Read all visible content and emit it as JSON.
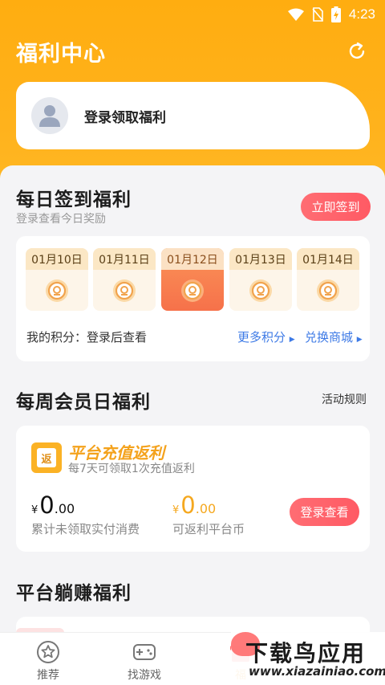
{
  "status_bar": {
    "time": "4:23"
  },
  "header": {
    "title": "福利中心"
  },
  "login_card": {
    "text": "登录领取福利"
  },
  "daily": {
    "title": "每日签到福利",
    "subtitle": "登录查看今日奖励",
    "button": "立即签到",
    "days": [
      "01月10日",
      "01月11日",
      "01月12日",
      "01月13日",
      "01月14日"
    ],
    "active_index": 2,
    "points_label": "我的积分：登录后查看",
    "more_points": "更多积分",
    "exchange": "兑换商城"
  },
  "weekly": {
    "title": "每周会员日福利",
    "rules": "活动规则",
    "badge_char": "返",
    "card_title": "平台充值返利",
    "card_desc": "每7天可领取1次充值返利",
    "left_currency": "¥",
    "left_int": "0",
    "left_dec": ".00",
    "left_caption": "累计未领取实付消费",
    "right_currency": "¥",
    "right_int": "0",
    "right_dec": ".00",
    "right_caption": "可返利平台币",
    "button": "登录查看"
  },
  "lying": {
    "title": "平台躺赚福利"
  },
  "tabs": [
    {
      "label": "推荐",
      "icon": "star-icon"
    },
    {
      "label": "找游戏",
      "icon": "gamepad-icon"
    },
    {
      "label": "福",
      "icon": "gift-icon"
    }
  ],
  "watermark": {
    "title": "下载鸟应用",
    "url": "www.xiazainiao.com"
  },
  "colors": {
    "accent": "#ffad10",
    "button": "#ff5a64",
    "gold": "#f5a81f",
    "link": "#3d7ae6"
  }
}
